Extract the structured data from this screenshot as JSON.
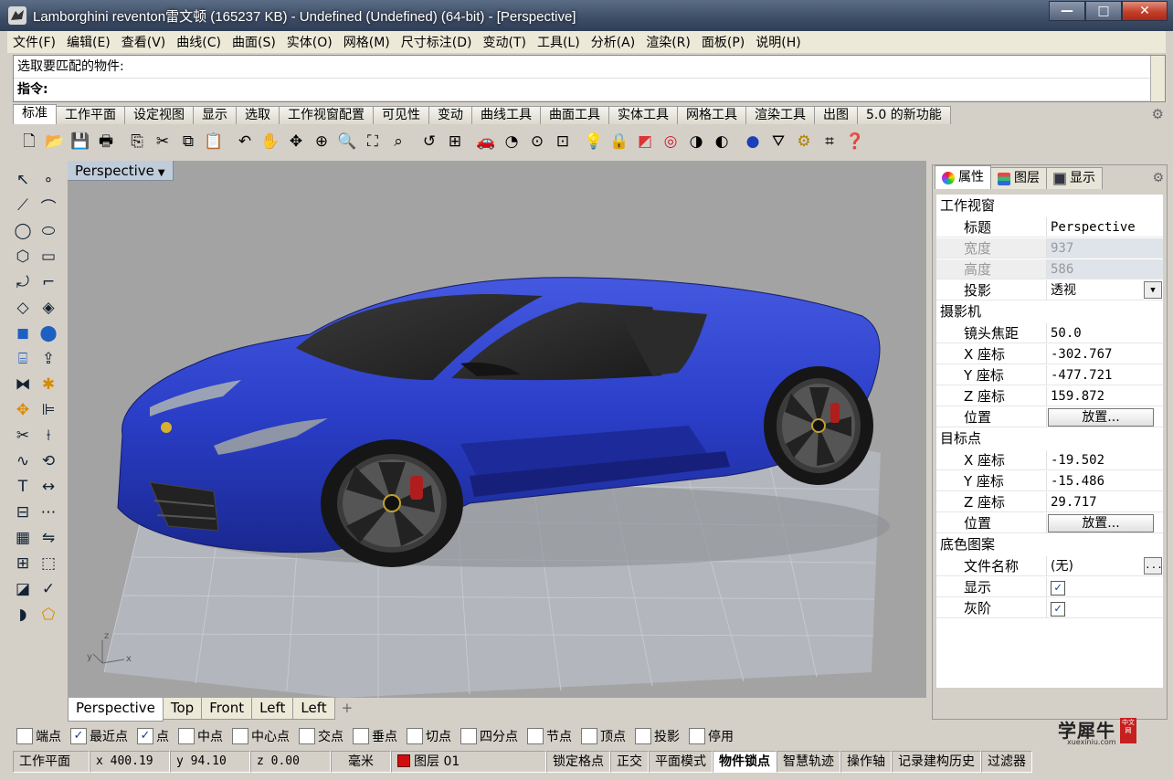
{
  "window": {
    "title": "Lamborghini reventon雷文顿 (165237 KB) - Undefined (Undefined) (64-bit) - [Perspective]",
    "controls": [
      "—",
      "□",
      "✕"
    ]
  },
  "menu": [
    "文件(F)",
    "编辑(E)",
    "查看(V)",
    "曲线(C)",
    "曲面(S)",
    "实体(O)",
    "网格(M)",
    "尺寸标注(D)",
    "变动(T)",
    "工具(L)",
    "分析(A)",
    "渲染(R)",
    "面板(P)",
    "说明(H)"
  ],
  "command": {
    "history": "选取要匹配的物件:",
    "prompt": "指令:"
  },
  "toolbar_tabs": [
    "标准",
    "工作平面",
    "设定视图",
    "显示",
    "选取",
    "工作视窗配置",
    "可见性",
    "变动",
    "曲线工具",
    "曲面工具",
    "实体工具",
    "网格工具",
    "渲染工具",
    "出图",
    "5.0 的新功能"
  ],
  "toolbar_icons": [
    "new-icon",
    "open-icon",
    "save-icon",
    "print-icon",
    "import-icon",
    "cut-icon",
    "copy-icon",
    "paste-icon",
    "undo-icon",
    "pan-icon",
    "rotate-view-icon",
    "zoom-window-icon",
    "zoom-dynamic-icon",
    "zoom-extents-icon",
    "zoom-selected-icon",
    "undo-view-icon",
    "four-viewports-icon",
    "car-icon",
    "render-preview-icon",
    "grid-snap-icon",
    "osnap-icon",
    "light-icon",
    "lock-icon",
    "layer-icon",
    "color-wheel-icon",
    "shade-icon",
    "render-icon",
    "sphere-icon",
    "select-filter-icon",
    "options-gear-icon",
    "units-icon",
    "help-icon"
  ],
  "viewport": {
    "name": "Perspective",
    "axes": {
      "z": "z",
      "y": "y",
      "x": "x"
    }
  },
  "viewport_tabs": [
    "Perspective",
    "Top",
    "Front",
    "Left",
    "Left",
    "+"
  ],
  "panel": {
    "tabs": [
      "属性",
      "图层",
      "显示"
    ],
    "sections": {
      "viewport": "工作视窗",
      "camera": "摄影机",
      "target": "目标点",
      "background": "底色图案"
    },
    "rows": {
      "title": {
        "label": "标题",
        "value": "Perspective"
      },
      "width": {
        "label": "宽度",
        "value": "937"
      },
      "height": {
        "label": "高度",
        "value": "586"
      },
      "projection": {
        "label": "投影",
        "value": "透视"
      },
      "lens": {
        "label": "镜头焦距",
        "value": "50.0"
      },
      "cam_x": {
        "label": "X 座标",
        "value": "-302.767"
      },
      "cam_y": {
        "label": "Y 座标",
        "value": "-477.721"
      },
      "cam_z": {
        "label": "Z 座标",
        "value": "159.872"
      },
      "cam_pos": {
        "label": "位置",
        "value": "放置..."
      },
      "tgt_x": {
        "label": "X 座标",
        "value": "-19.502"
      },
      "tgt_y": {
        "label": "Y 座标",
        "value": "-15.486"
      },
      "tgt_z": {
        "label": "Z 座标",
        "value": "29.717"
      },
      "tgt_pos": {
        "label": "位置",
        "value": "放置..."
      },
      "filename": {
        "label": "文件名称",
        "value": "(无)"
      },
      "show": {
        "label": "显示",
        "checked": true
      },
      "gray": {
        "label": "灰阶",
        "checked": true
      }
    }
  },
  "osnaps": [
    {
      "label": "端点",
      "checked": false
    },
    {
      "label": "最近点",
      "checked": true
    },
    {
      "label": "点",
      "checked": true
    },
    {
      "label": "中点",
      "checked": false
    },
    {
      "label": "中心点",
      "checked": false
    },
    {
      "label": "交点",
      "checked": false
    },
    {
      "label": "垂点",
      "checked": false
    },
    {
      "label": "切点",
      "checked": false
    },
    {
      "label": "四分点",
      "checked": false
    },
    {
      "label": "节点",
      "checked": false
    },
    {
      "label": "顶点",
      "checked": false
    },
    {
      "label": "投影",
      "checked": false
    },
    {
      "label": "停用",
      "checked": false
    }
  ],
  "watermark": {
    "text": "学犀牛",
    "url": "xuexiniu.com",
    "seal": "中文网"
  },
  "status": {
    "cplane": "工作平面",
    "x": "x 400.19",
    "y": "y 94.10",
    "z": "z 0.00",
    "units": "毫米",
    "layer": "图层 01",
    "toggles": [
      "锁定格点",
      "正交",
      "平面模式",
      "物件锁点",
      "智慧轨迹",
      "操作轴",
      "记录建构历史",
      "过滤器"
    ]
  },
  "colors": {
    "car_body": "#2a3ec8",
    "layer_swatch": "#d10d0d",
    "viewport_bg": "#a3a3a3",
    "grid": "#b6bcc6"
  }
}
